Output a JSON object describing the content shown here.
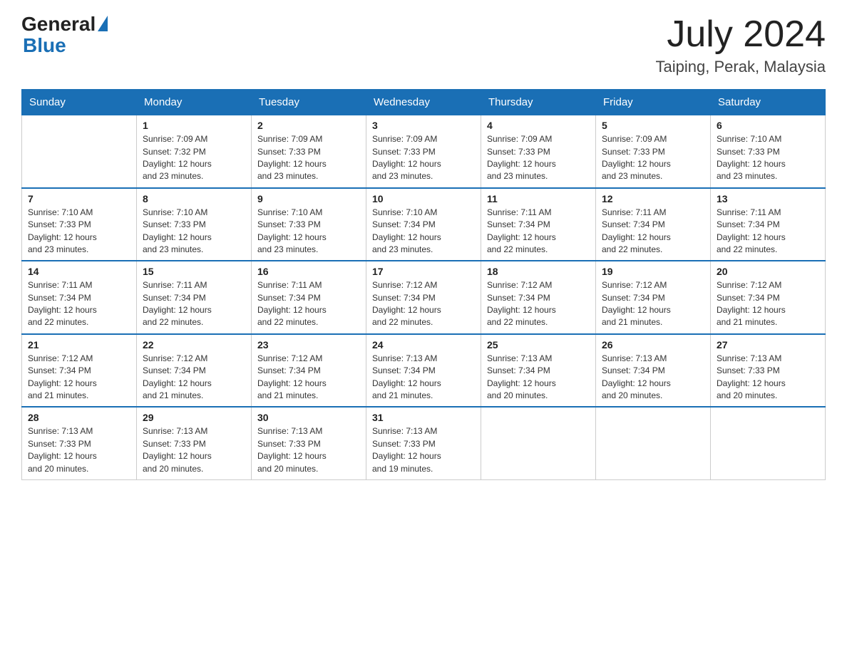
{
  "header": {
    "logo_general": "General",
    "logo_blue": "Blue",
    "month_year": "July 2024",
    "location": "Taiping, Perak, Malaysia"
  },
  "days_of_week": [
    "Sunday",
    "Monday",
    "Tuesday",
    "Wednesday",
    "Thursday",
    "Friday",
    "Saturday"
  ],
  "weeks": [
    [
      {
        "day": "",
        "info": ""
      },
      {
        "day": "1",
        "info": "Sunrise: 7:09 AM\nSunset: 7:32 PM\nDaylight: 12 hours\nand 23 minutes."
      },
      {
        "day": "2",
        "info": "Sunrise: 7:09 AM\nSunset: 7:33 PM\nDaylight: 12 hours\nand 23 minutes."
      },
      {
        "day": "3",
        "info": "Sunrise: 7:09 AM\nSunset: 7:33 PM\nDaylight: 12 hours\nand 23 minutes."
      },
      {
        "day": "4",
        "info": "Sunrise: 7:09 AM\nSunset: 7:33 PM\nDaylight: 12 hours\nand 23 minutes."
      },
      {
        "day": "5",
        "info": "Sunrise: 7:09 AM\nSunset: 7:33 PM\nDaylight: 12 hours\nand 23 minutes."
      },
      {
        "day": "6",
        "info": "Sunrise: 7:10 AM\nSunset: 7:33 PM\nDaylight: 12 hours\nand 23 minutes."
      }
    ],
    [
      {
        "day": "7",
        "info": "Sunrise: 7:10 AM\nSunset: 7:33 PM\nDaylight: 12 hours\nand 23 minutes."
      },
      {
        "day": "8",
        "info": "Sunrise: 7:10 AM\nSunset: 7:33 PM\nDaylight: 12 hours\nand 23 minutes."
      },
      {
        "day": "9",
        "info": "Sunrise: 7:10 AM\nSunset: 7:33 PM\nDaylight: 12 hours\nand 23 minutes."
      },
      {
        "day": "10",
        "info": "Sunrise: 7:10 AM\nSunset: 7:34 PM\nDaylight: 12 hours\nand 23 minutes."
      },
      {
        "day": "11",
        "info": "Sunrise: 7:11 AM\nSunset: 7:34 PM\nDaylight: 12 hours\nand 22 minutes."
      },
      {
        "day": "12",
        "info": "Sunrise: 7:11 AM\nSunset: 7:34 PM\nDaylight: 12 hours\nand 22 minutes."
      },
      {
        "day": "13",
        "info": "Sunrise: 7:11 AM\nSunset: 7:34 PM\nDaylight: 12 hours\nand 22 minutes."
      }
    ],
    [
      {
        "day": "14",
        "info": "Sunrise: 7:11 AM\nSunset: 7:34 PM\nDaylight: 12 hours\nand 22 minutes."
      },
      {
        "day": "15",
        "info": "Sunrise: 7:11 AM\nSunset: 7:34 PM\nDaylight: 12 hours\nand 22 minutes."
      },
      {
        "day": "16",
        "info": "Sunrise: 7:11 AM\nSunset: 7:34 PM\nDaylight: 12 hours\nand 22 minutes."
      },
      {
        "day": "17",
        "info": "Sunrise: 7:12 AM\nSunset: 7:34 PM\nDaylight: 12 hours\nand 22 minutes."
      },
      {
        "day": "18",
        "info": "Sunrise: 7:12 AM\nSunset: 7:34 PM\nDaylight: 12 hours\nand 22 minutes."
      },
      {
        "day": "19",
        "info": "Sunrise: 7:12 AM\nSunset: 7:34 PM\nDaylight: 12 hours\nand 21 minutes."
      },
      {
        "day": "20",
        "info": "Sunrise: 7:12 AM\nSunset: 7:34 PM\nDaylight: 12 hours\nand 21 minutes."
      }
    ],
    [
      {
        "day": "21",
        "info": "Sunrise: 7:12 AM\nSunset: 7:34 PM\nDaylight: 12 hours\nand 21 minutes."
      },
      {
        "day": "22",
        "info": "Sunrise: 7:12 AM\nSunset: 7:34 PM\nDaylight: 12 hours\nand 21 minutes."
      },
      {
        "day": "23",
        "info": "Sunrise: 7:12 AM\nSunset: 7:34 PM\nDaylight: 12 hours\nand 21 minutes."
      },
      {
        "day": "24",
        "info": "Sunrise: 7:13 AM\nSunset: 7:34 PM\nDaylight: 12 hours\nand 21 minutes."
      },
      {
        "day": "25",
        "info": "Sunrise: 7:13 AM\nSunset: 7:34 PM\nDaylight: 12 hours\nand 20 minutes."
      },
      {
        "day": "26",
        "info": "Sunrise: 7:13 AM\nSunset: 7:34 PM\nDaylight: 12 hours\nand 20 minutes."
      },
      {
        "day": "27",
        "info": "Sunrise: 7:13 AM\nSunset: 7:33 PM\nDaylight: 12 hours\nand 20 minutes."
      }
    ],
    [
      {
        "day": "28",
        "info": "Sunrise: 7:13 AM\nSunset: 7:33 PM\nDaylight: 12 hours\nand 20 minutes."
      },
      {
        "day": "29",
        "info": "Sunrise: 7:13 AM\nSunset: 7:33 PM\nDaylight: 12 hours\nand 20 minutes."
      },
      {
        "day": "30",
        "info": "Sunrise: 7:13 AM\nSunset: 7:33 PM\nDaylight: 12 hours\nand 20 minutes."
      },
      {
        "day": "31",
        "info": "Sunrise: 7:13 AM\nSunset: 7:33 PM\nDaylight: 12 hours\nand 19 minutes."
      },
      {
        "day": "",
        "info": ""
      },
      {
        "day": "",
        "info": ""
      },
      {
        "day": "",
        "info": ""
      }
    ]
  ]
}
